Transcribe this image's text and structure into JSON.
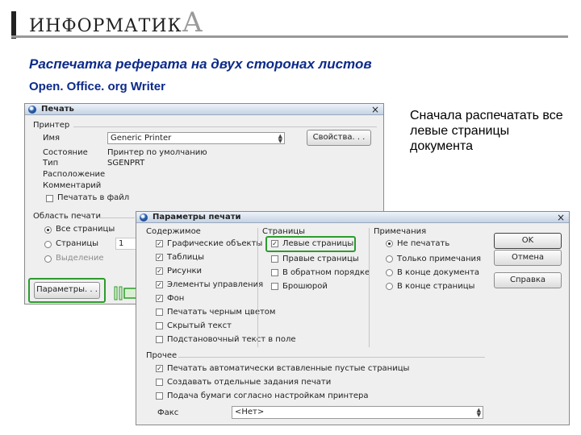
{
  "header": {
    "brand_main": "ИНФОРМАТИК",
    "brand_tail": "А",
    "title": "Распечатка реферата на двух сторонах листов",
    "subtitle": "Open. Office. org Writer",
    "note": "Сначала распечатать все левые страницы документа"
  },
  "print_dialog": {
    "title": "Печать",
    "close": "×",
    "printer_group": "Принтер",
    "name_label": "Имя",
    "name_value": "Generic Printer",
    "properties_button": "Свойства. . .",
    "state_label": "Состояние",
    "state_value": "Принтер по умолчанию",
    "type_label": "Тип",
    "type_value": "SGENPRT",
    "location_label": "Расположение",
    "comment_label": "Комментарий",
    "print_to_file": "Печатать в файл",
    "range_group": "Область печати",
    "all_pages": "Все страницы",
    "pages": "Страницы",
    "pages_value": "1",
    "selection": "Выделение",
    "params_button": "Параметры. . ."
  },
  "options_dialog": {
    "title": "Параметры печати",
    "close": "×",
    "contents_group": "Содержимое",
    "contents": [
      {
        "label": "Графические объекты",
        "checked": true
      },
      {
        "label": "Таблицы",
        "checked": true
      },
      {
        "label": "Рисунки",
        "checked": true
      },
      {
        "label": "Элементы управления",
        "checked": true
      },
      {
        "label": "Фон",
        "checked": true
      },
      {
        "label": "Печатать черным цветом",
        "checked": false
      },
      {
        "label": "Скрытый текст",
        "checked": false
      },
      {
        "label": "Подстановочный текст в поле",
        "checked": false
      }
    ],
    "pages_group": "Страницы",
    "pages": [
      {
        "label": "Левые страницы",
        "checked": true
      },
      {
        "label": "Правые страницы",
        "checked": false
      },
      {
        "label": "В обратном порядке",
        "checked": false
      },
      {
        "label": "Брошюрой",
        "checked": false
      }
    ],
    "notes_group": "Примечания",
    "notes": [
      {
        "label": "Не печатать",
        "selected": true
      },
      {
        "label": "Только примечания",
        "selected": false
      },
      {
        "label": "В конце документа",
        "selected": false
      },
      {
        "label": "В конце страницы",
        "selected": false
      }
    ],
    "other_group": "Прочее",
    "other": [
      {
        "label": "Печатать автоматически вставленные пустые страницы",
        "checked": true
      },
      {
        "label": "Создавать отдельные задания печати",
        "checked": false
      },
      {
        "label": "Подача бумаги согласно настройкам принтера",
        "checked": false
      }
    ],
    "fax_label": "Факс",
    "fax_value": "<Нет>",
    "ok_button": "OK",
    "cancel_button": "Отмена",
    "help_button": "Справка"
  },
  "colors": {
    "title_blue": "#0c2a8a",
    "highlight_green": "#2e9b2e"
  }
}
